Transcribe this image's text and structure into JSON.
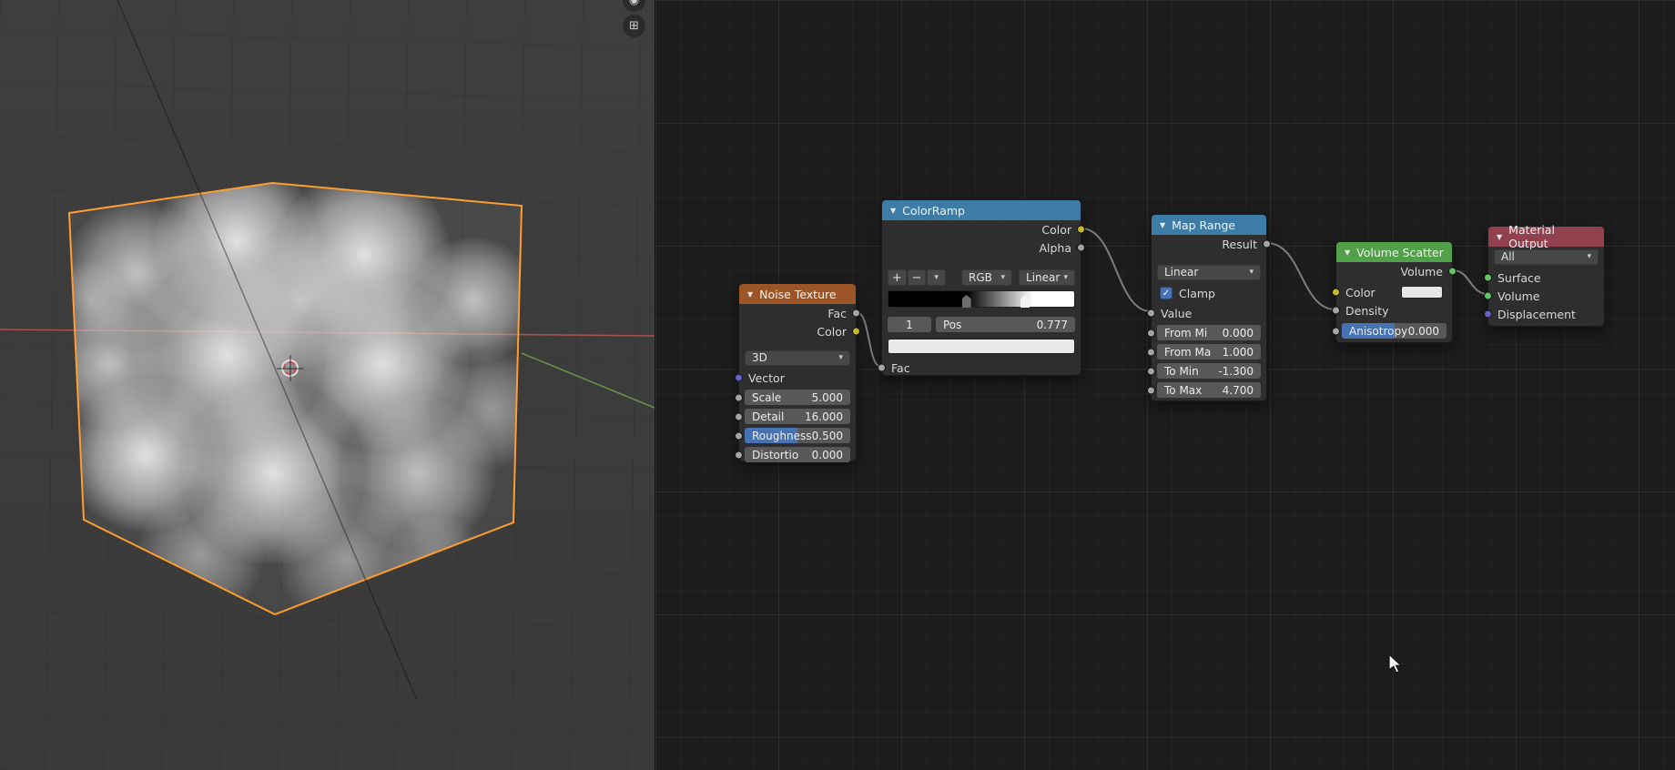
{
  "glyphs": {
    "collapse": "▼",
    "caret": "▾",
    "check": "✓",
    "camera_gizmo": "◉",
    "grid_gizmo": "⊞",
    "add": "+",
    "remove": "−"
  },
  "colors": {
    "selection_outline": "#ff9d2e",
    "header_texture": "#9b5526",
    "header_converter": "#3d7ca6",
    "header_shader": "#52a04a",
    "header_output": "#93404e",
    "slider_fill": "#4772b3",
    "socket_value": "#a5a5a5",
    "socket_color": "#c8b826",
    "socket_vector": "#6363c7",
    "socket_shader": "#63c763"
  },
  "nodes": {
    "noise_texture": {
      "title": "Noise Texture",
      "output_fac": "Fac",
      "output_color": "Color",
      "dimensions": "3D",
      "input_vector": "Vector",
      "scale_label": "Scale",
      "scale_value": "5.000",
      "detail_label": "Detail",
      "detail_value": "16.000",
      "roughness_label": "Roughness",
      "roughness_value": "0.500",
      "distortion_label": "Distortio",
      "distortion_value": "0.000"
    },
    "color_ramp": {
      "title": "ColorRamp",
      "output_color": "Color",
      "output_alpha": "Alpha",
      "color_mode": "RGB",
      "interpolation": "Linear",
      "index_value": "1",
      "pos_label": "Pos",
      "pos_value": "0.777",
      "input_fac": "Fac"
    },
    "map_range": {
      "title": "Map Range",
      "output_result": "Result",
      "interpolation": "Linear",
      "clamp_label": "Clamp",
      "input_value": "Value",
      "from_min_label": "From Mi",
      "from_min_value": "0.000",
      "from_max_label": "From Ma",
      "from_max_value": "1.000",
      "to_min_label": "To Min",
      "to_min_value": "-1.300",
      "to_max_label": "To Max",
      "to_max_value": "4.700"
    },
    "volume_scatter": {
      "title": "Volume Scatter",
      "output_volume": "Volume",
      "input_color": "Color",
      "input_density": "Density",
      "anisotropy_label": "Anisotropy",
      "anisotropy_value": "0.000"
    },
    "material_output": {
      "title": "Material Output",
      "target": "All",
      "input_surface": "Surface",
      "input_volume": "Volume",
      "input_displacement": "Displacement"
    }
  }
}
